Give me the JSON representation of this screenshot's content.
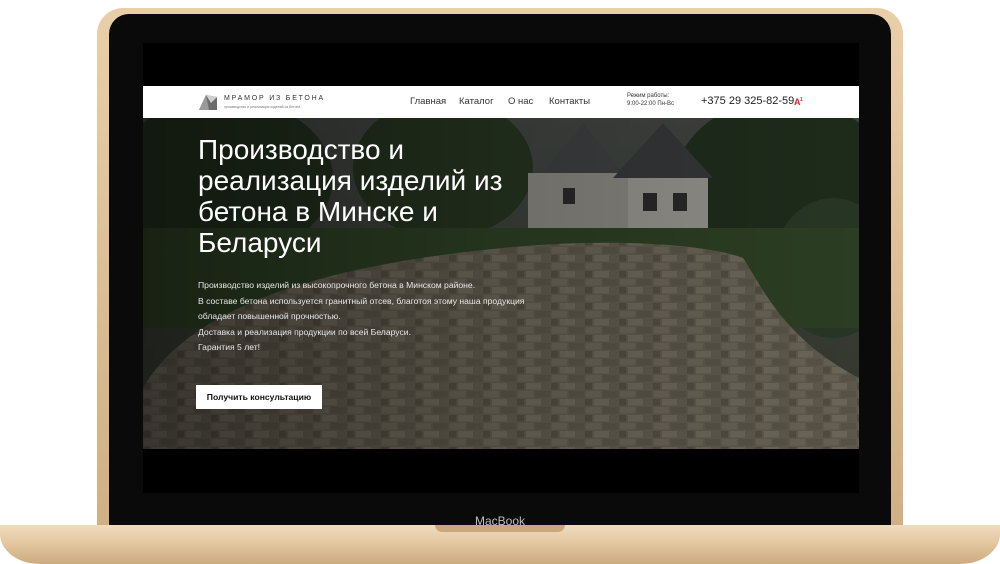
{
  "device": {
    "brand_label": "MacBook"
  },
  "site": {
    "logo": {
      "title": "МРАМОР ИЗ БЕТОНА",
      "subtitle": "производство и реализация изделий из бетона"
    },
    "nav": [
      {
        "label": "Главная"
      },
      {
        "label": "Каталог"
      },
      {
        "label": "О нас"
      },
      {
        "label": "Контакты"
      }
    ],
    "hours": {
      "label": "Режим работы:",
      "value": "9:00-22:00 Пн-Вс"
    },
    "phone": "+375 29 325-82-59",
    "operator_icon": "a1-operator-icon",
    "hero": {
      "title": "Производство и реализация изделий из бетона в Минске и Беларуси",
      "lines": [
        "Производство изделий из высокопрочного бетона в Минском районе.",
        "В составе бетона используется гранитный отсев, благотоя этому наша продукция",
        "обладает повышенной прочностью.",
        "Доставка и реализация продукции по всей Беларуси.",
        "Гарантия 5 лет!"
      ],
      "cta_label": "Получить консультацию"
    },
    "colors": {
      "operator_red": "#d8232a",
      "nav_bg": "#ffffff",
      "cta_bg": "#ffffff"
    }
  }
}
